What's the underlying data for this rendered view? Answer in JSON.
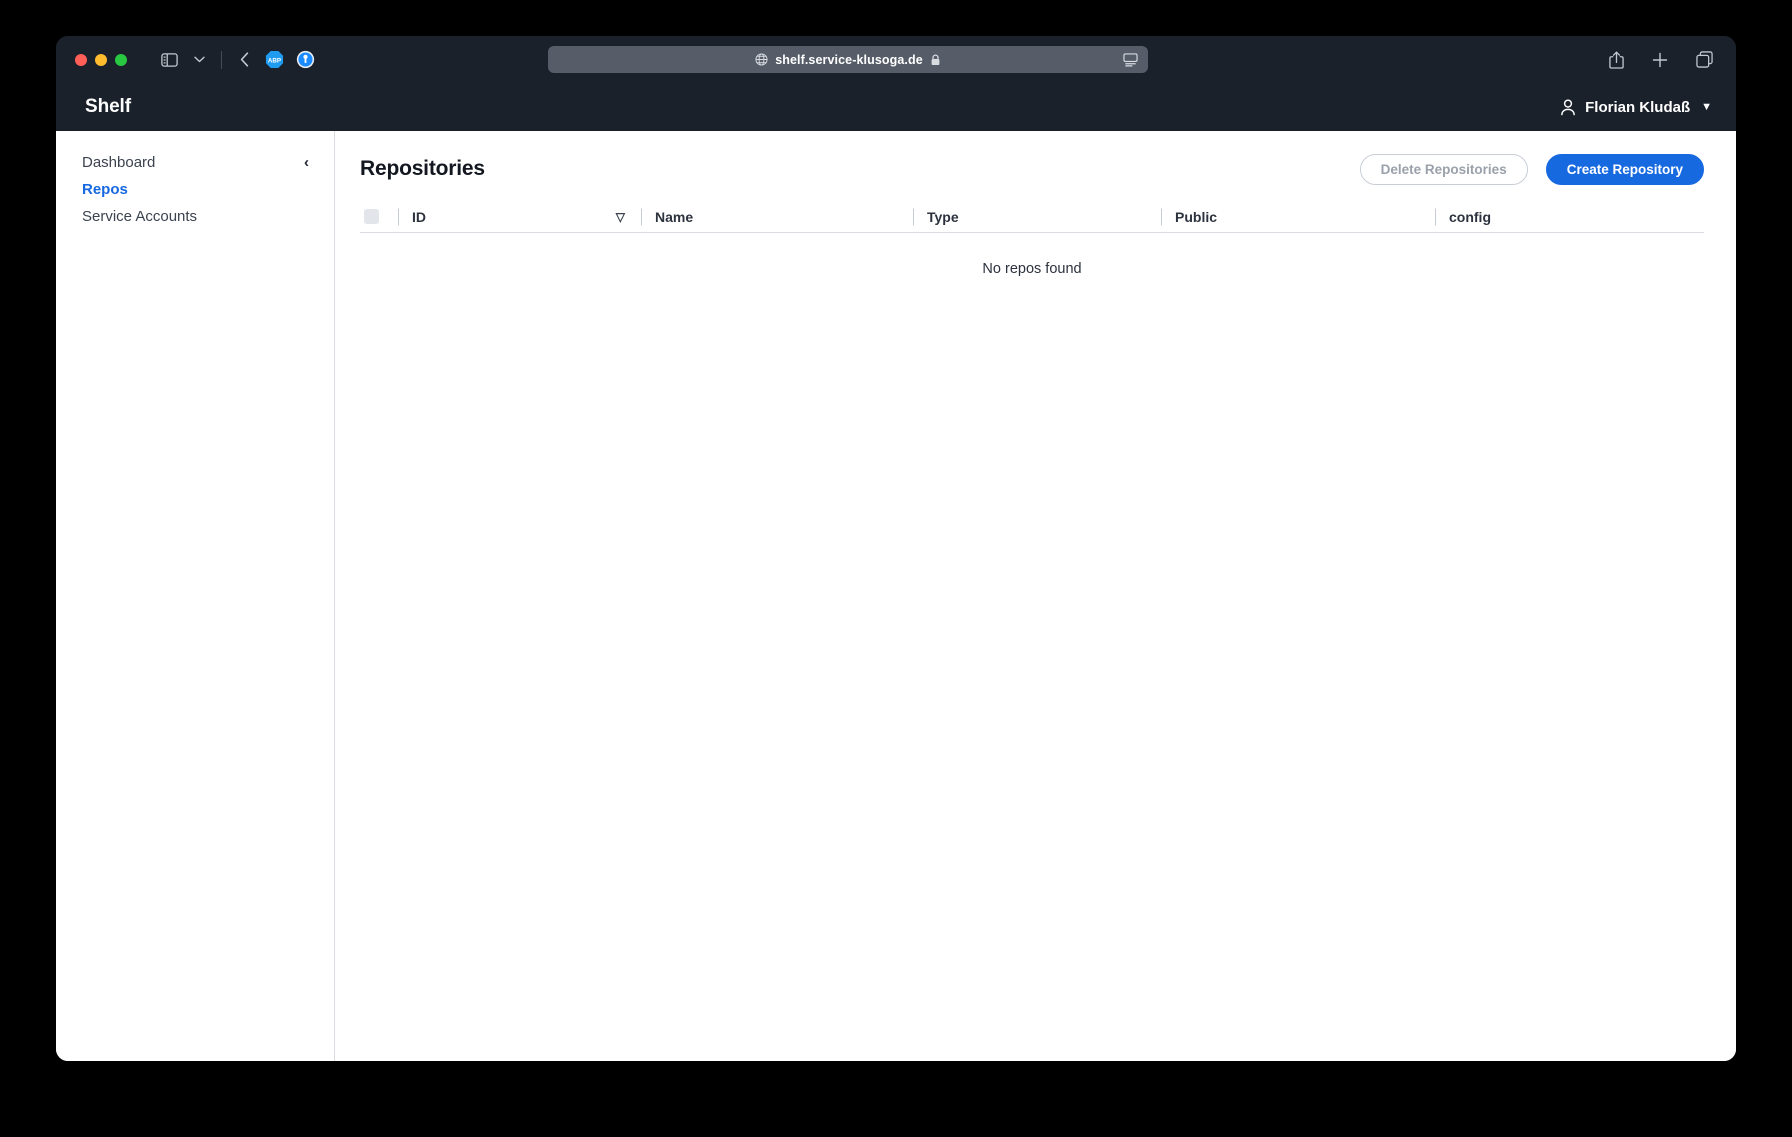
{
  "browser": {
    "traffic_lights": [
      "close",
      "minimize",
      "maximize"
    ],
    "sidebar_toggle_icon": "sidebar-icon",
    "sidebar_dropdown_icon": "chevron-down-icon",
    "back_icon": "back-chevron-icon",
    "extensions": [
      {
        "name": "adblock-plus",
        "label": "ABP",
        "color": "#1f9cf0"
      },
      {
        "name": "1password",
        "label": "1",
        "color": "#1a8cff"
      }
    ],
    "url": {
      "globe_icon": "globe-icon",
      "text": "shelf.service-klusoga.de",
      "lock_icon": "lock-icon",
      "reader_icon": "reader-view-icon"
    },
    "right_icons": [
      {
        "name": "share-icon"
      },
      {
        "name": "new-tab-icon"
      },
      {
        "name": "tab-overview-icon"
      }
    ]
  },
  "app": {
    "title": "Shelf",
    "user": {
      "avatar_icon": "person-icon",
      "name": "Florian Kludaß",
      "caret": "▼"
    }
  },
  "sidebar": {
    "collapse_icon": "‹",
    "items": [
      {
        "label": "Dashboard",
        "active": false
      },
      {
        "label": "Repos",
        "active": true
      },
      {
        "label": "Service Accounts",
        "active": false
      }
    ]
  },
  "main": {
    "page_title": "Repositories",
    "actions": {
      "delete_label": "Delete Repositories",
      "create_label": "Create Repository"
    },
    "table": {
      "select_all_checkbox": "select-all",
      "columns": [
        {
          "label": "ID",
          "sort": "▽"
        },
        {
          "label": "Name",
          "sort": ""
        },
        {
          "label": "Type",
          "sort": ""
        },
        {
          "label": "Public",
          "sort": ""
        },
        {
          "label": "config",
          "sort": ""
        }
      ],
      "rows": [],
      "empty_message": "No repos found"
    }
  },
  "colors": {
    "accent": "#1769e0",
    "chrome_dark": "#1b212b",
    "url_bar": "#565d68",
    "page_bg": "#ffffff",
    "border": "#d9dde2"
  }
}
